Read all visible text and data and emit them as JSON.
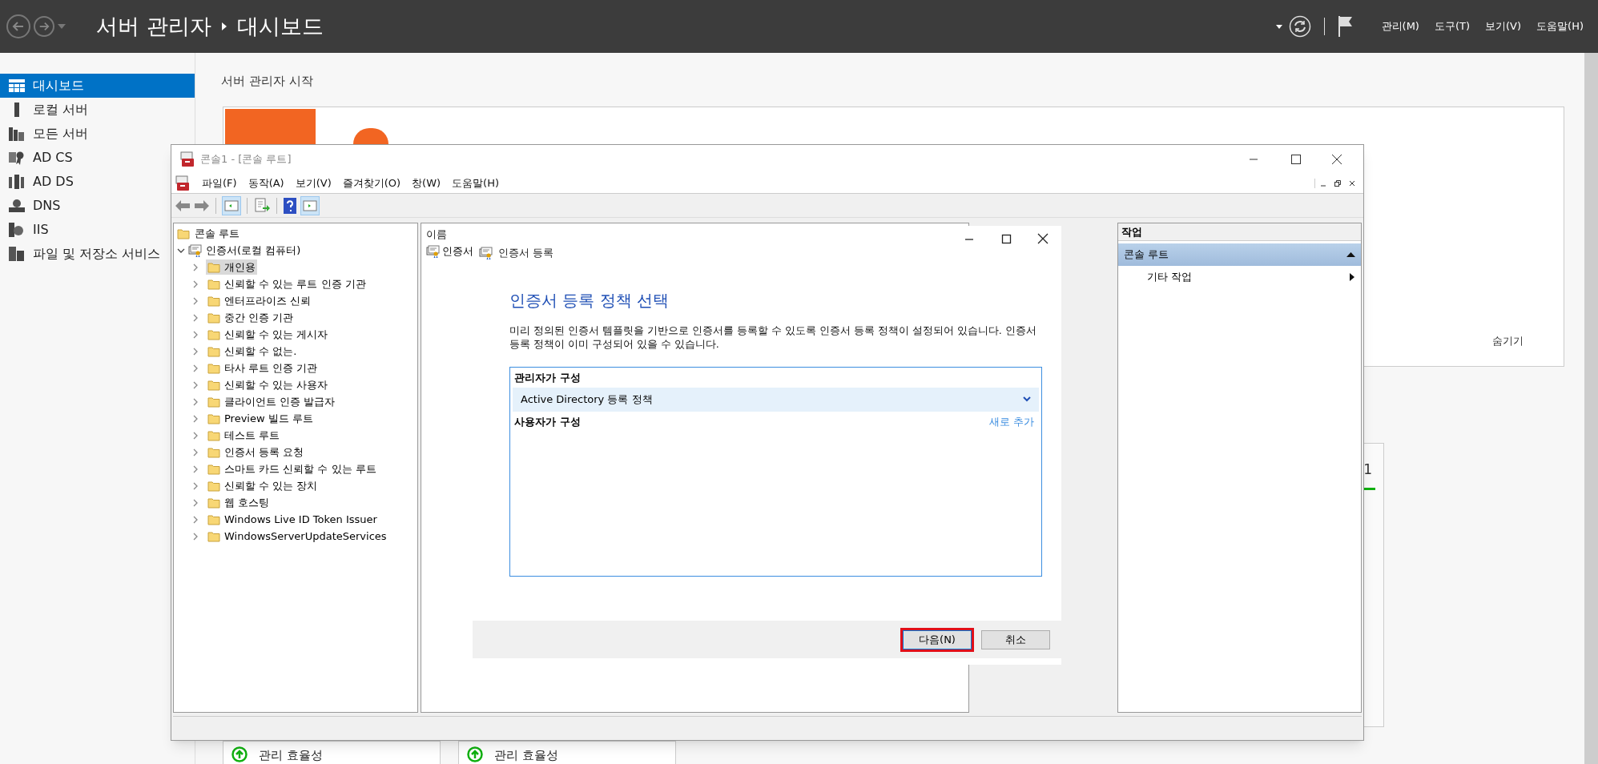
{
  "header": {
    "title": "서버 관리자",
    "page": "대시보드",
    "menu": [
      "관리(M)",
      "도구(T)",
      "보기(V)",
      "도움말(H)"
    ]
  },
  "sidebar": {
    "items": [
      {
        "label": "대시보드",
        "selected": true
      },
      {
        "label": "로컬 서버",
        "selected": false
      },
      {
        "label": "모든 서버",
        "selected": false
      },
      {
        "label": "AD CS",
        "selected": false
      },
      {
        "label": "AD DS",
        "selected": false
      },
      {
        "label": "DNS",
        "selected": false
      },
      {
        "label": "IIS",
        "selected": false
      },
      {
        "label": "파일 및 저장소 서비스",
        "selected": false
      }
    ]
  },
  "content": {
    "heading": "서버 관리자 시작",
    "welcome": {
      "hide_link": "숨기기"
    },
    "tile_count": "1",
    "tiles": [
      {
        "label": "관리 효율성"
      },
      {
        "label": "관리 효율성"
      }
    ]
  },
  "mmc": {
    "title": "콘솔1 - [콘솔 루트]",
    "menu": [
      "파일(F)",
      "동작(A)",
      "보기(V)",
      "즐겨찾기(O)",
      "창(W)",
      "도움말(H)"
    ],
    "tree": {
      "label": "콘솔 루트",
      "children": [
        {
          "label": "인증서(로컬 컴퓨터)",
          "expanded": true,
          "children": [
            {
              "label": "개인용",
              "selected": true
            },
            {
              "label": "신뢰할 수 있는 루트 인증 기관",
              "selected": false
            },
            {
              "label": "엔터프라이즈 신뢰",
              "selected": false
            },
            {
              "label": "중간 인증 기관",
              "selected": false
            },
            {
              "label": "신뢰할 수 있는 게시자",
              "selected": false
            },
            {
              "label": "신뢰할 수 없는.",
              "selected": false
            },
            {
              "label": "타사 루트 인증 기관",
              "selected": false
            },
            {
              "label": "신뢰할 수 있는 사용자",
              "selected": false
            },
            {
              "label": "클라이언트 인증 발급자",
              "selected": false
            },
            {
              "label": "Preview 빌드 루트",
              "selected": false
            },
            {
              "label": "테스트 루트",
              "selected": false
            },
            {
              "label": "인증서 등록 요청",
              "selected": false
            },
            {
              "label": "스마트 카드 신뢰할 수 있는 루트",
              "selected": false
            },
            {
              "label": "신뢰할 수 있는 장치",
              "selected": false
            },
            {
              "label": "웹 호스팅",
              "selected": false
            },
            {
              "label": "Windows Live ID Token Issuer",
              "selected": false
            },
            {
              "label": "WindowsServerUpdateServices",
              "selected": false
            }
          ]
        }
      ]
    },
    "list_header": "이름",
    "list_items": [
      "인증서"
    ],
    "actions": {
      "header": "작업",
      "section": "콘솔 루트",
      "items": [
        "기타 작업"
      ]
    }
  },
  "dialog": {
    "window_title": "인증서 등록",
    "heading": "인증서 등록 정책 선택",
    "description": "미리 정의된 인증서 템플릿을 기반으로 인증서를 등록할 수 있도록 인증서 등록 정책이 설정되어 있습니다. 인증서 등록 정책이 이미 구성되어 있을 수 있습니다.",
    "admin_group": "관리자가 구성",
    "admin_policies": [
      {
        "label": "Active Directory 등록 정책",
        "selected": true
      }
    ],
    "user_group": "사용자가 구성",
    "add_link": "새로 추가",
    "buttons": [
      {
        "label": "다음(N)",
        "focused": true
      },
      {
        "label": "취소",
        "focused": false
      }
    ]
  }
}
